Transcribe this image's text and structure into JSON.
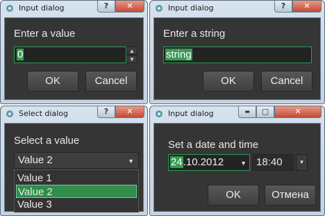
{
  "dialogs": {
    "d1": {
      "title": "Input dialog",
      "help": "?",
      "close": "✕",
      "label": "Enter a value",
      "value": "0",
      "ok": "OK",
      "cancel": "Cancel"
    },
    "d2": {
      "title": "Input dialog",
      "help": "?",
      "close": "✕",
      "label": "Enter a string",
      "value": "string",
      "ok": "OK",
      "cancel": "Cancel"
    },
    "d3": {
      "title": "Select dialog",
      "help": "?",
      "close": "✕",
      "label": "Select a value",
      "selected": "Value 2",
      "options": [
        "Value 1",
        "Value 2",
        "Value 3"
      ]
    },
    "d4": {
      "title": "Input dialog",
      "minimize": "▬",
      "maximize": "▢",
      "close": "✕",
      "label": "Set a date and time",
      "date_day": "24",
      "date_rest": ".10.2012",
      "time": "18:40",
      "ok": "OK",
      "cancel": "Отмена"
    }
  },
  "colors": {
    "accent": "#2f8f4a",
    "client_bg": "#353535",
    "frame": "#c3d3e3"
  },
  "icons": {
    "app": "app-icon",
    "spin_up": "chevron-up-icon",
    "spin_down": "chevron-down-icon",
    "dropdown": "chevron-down-icon"
  }
}
